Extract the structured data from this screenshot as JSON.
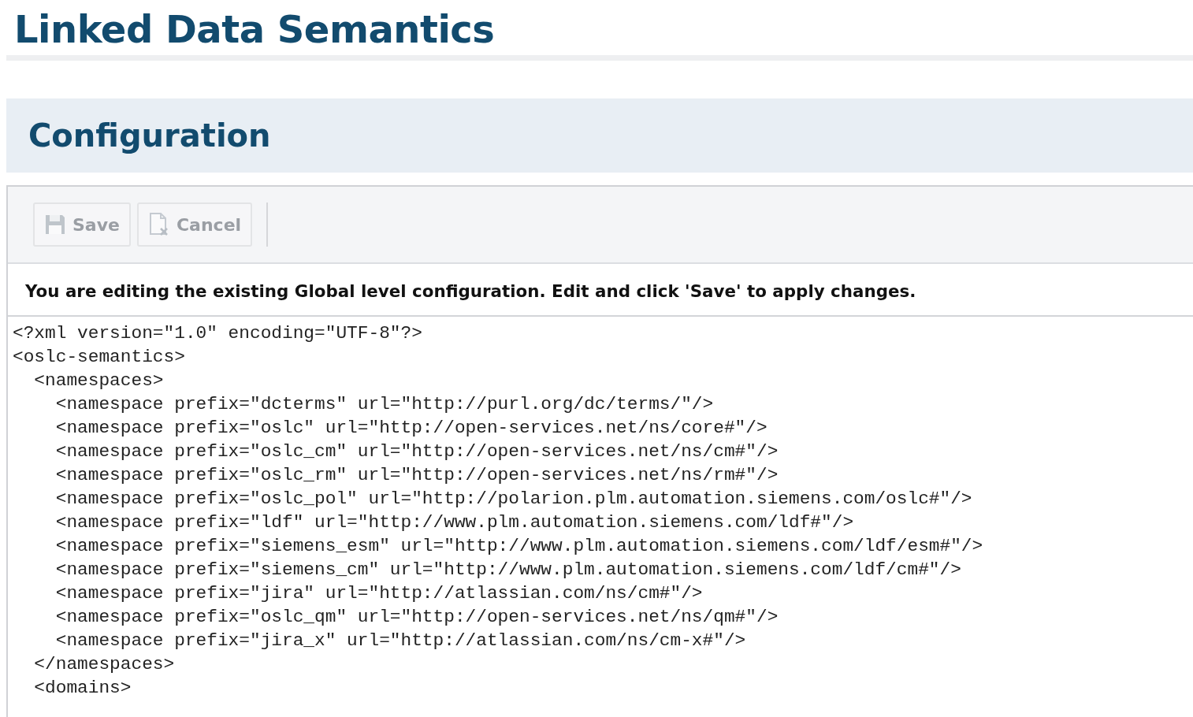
{
  "page_title": "Linked Data Semantics",
  "section": {
    "title": "Configuration"
  },
  "toolbar": {
    "buttons": [
      {
        "kind": "save",
        "label": "Save",
        "disabled": true
      },
      {
        "kind": "cancel",
        "label": "Cancel",
        "disabled": true
      }
    ]
  },
  "message": "You are editing the existing Global level configuration. Edit and click 'Save' to apply changes.",
  "editor": {
    "lines": [
      "<?xml version=\"1.0\" encoding=\"UTF-8\"?>",
      "<oslc-semantics>",
      "  <namespaces>",
      "    <namespace prefix=\"dcterms\" url=\"http://purl.org/dc/terms/\"/>",
      "    <namespace prefix=\"oslc\" url=\"http://open-services.net/ns/core#\"/>",
      "    <namespace prefix=\"oslc_cm\" url=\"http://open-services.net/ns/cm#\"/>",
      "    <namespace prefix=\"oslc_rm\" url=\"http://open-services.net/ns/rm#\"/>",
      "    <namespace prefix=\"oslc_pol\" url=\"http://polarion.plm.automation.siemens.com/oslc#\"/>",
      "    <namespace prefix=\"ldf\" url=\"http://www.plm.automation.siemens.com/ldf#\"/>",
      "    <namespace prefix=\"siemens_esm\" url=\"http://www.plm.automation.siemens.com/ldf/esm#\"/>",
      "    <namespace prefix=\"siemens_cm\" url=\"http://www.plm.automation.siemens.com/ldf/cm#\"/>",
      "    <namespace prefix=\"jira\" url=\"http://atlassian.com/ns/cm#\"/>",
      "    <namespace prefix=\"oslc_qm\" url=\"http://open-services.net/ns/qm#\"/>",
      "    <namespace prefix=\"jira_x\" url=\"http://atlassian.com/ns/cm-x#\"/>",
      "  </namespaces>",
      "  <domains>"
    ]
  }
}
